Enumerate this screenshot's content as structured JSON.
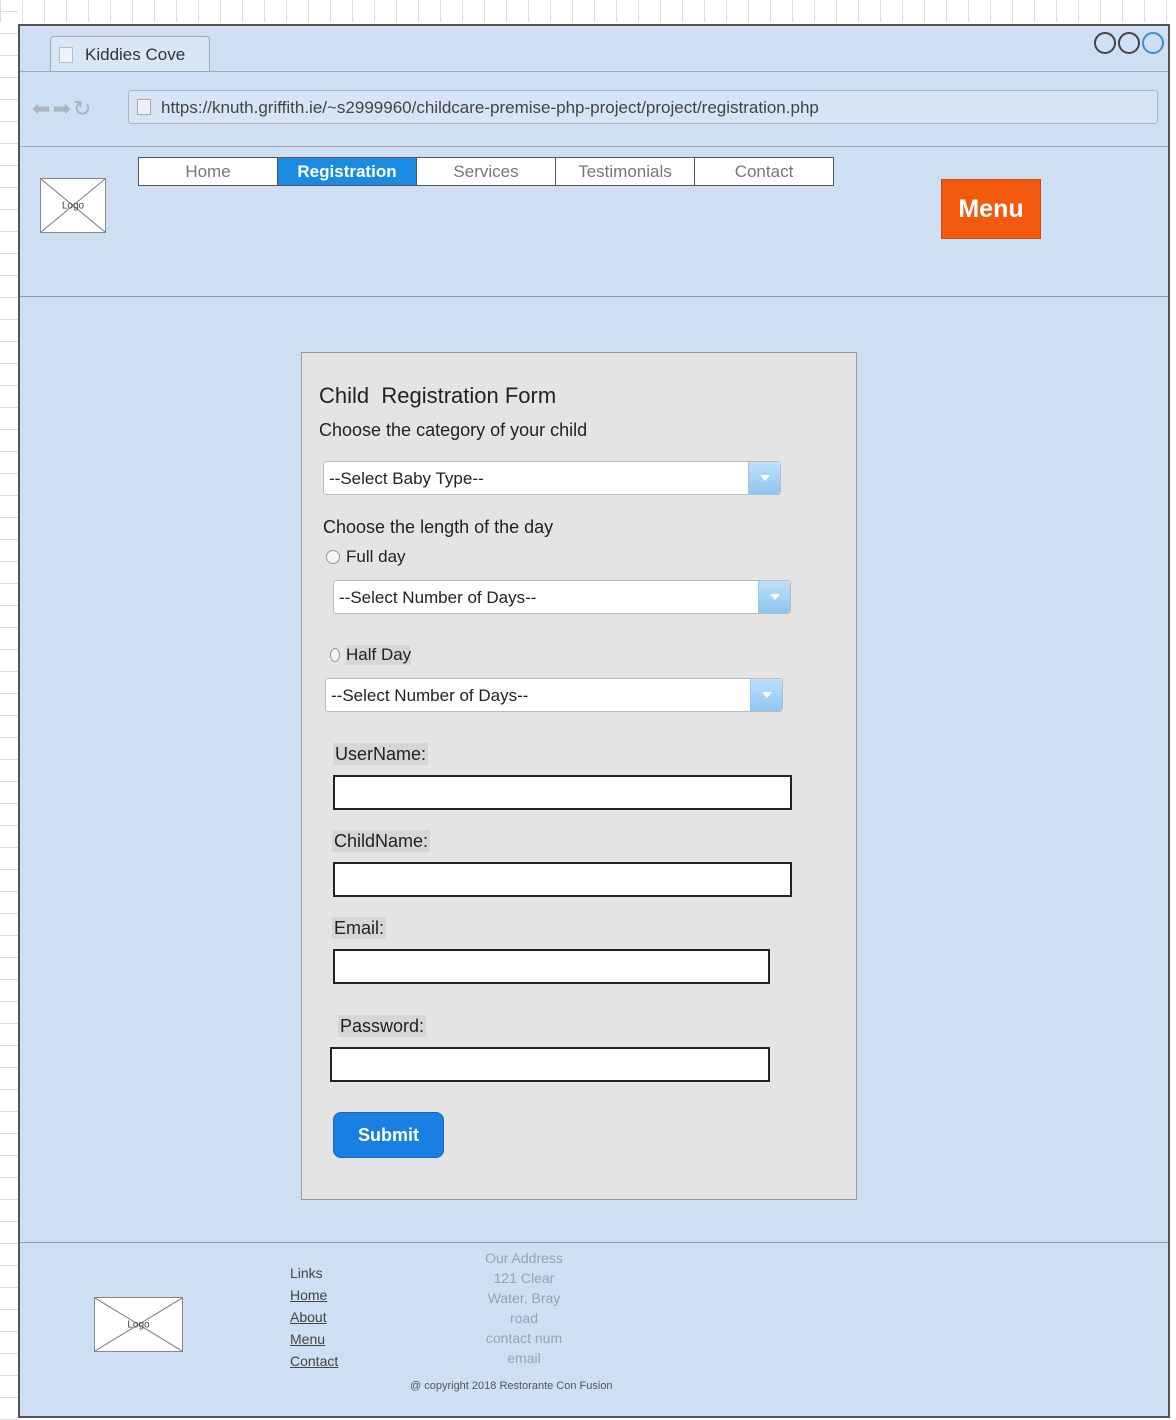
{
  "browser": {
    "tab_title": "Kiddies Cove",
    "url": "https://knuth.griffith.ie/~s2999960/childcare-premise-php-project/project/registration.php"
  },
  "header": {
    "logo_label": "Logo",
    "nav": [
      {
        "label": "Home"
      },
      {
        "label": "Registration"
      },
      {
        "label": "Services"
      },
      {
        "label": "Testimonials"
      },
      {
        "label": "Contact"
      }
    ],
    "active_nav": "Registration",
    "menu_label": "Menu"
  },
  "form": {
    "title": "Child  Registration Form",
    "category_prompt": "Choose the category of your child",
    "baby_type_select": "--Select Baby Type--",
    "day_length_prompt": "Choose the length of the day",
    "full_day_label": "Full day",
    "full_day_select": "--Select Number of Days--",
    "half_day_label": "Half Day",
    "half_day_select": "--Select Number of Days--",
    "username_label": "UserName:",
    "childname_label": "ChildName:",
    "email_label": "Email:",
    "password_label": "Password:",
    "submit_label": "Submit"
  },
  "footer": {
    "logo_label": "Logo",
    "links_heading": "Links",
    "links": [
      "Home",
      "About",
      "Menu",
      "Contact"
    ],
    "address": [
      "Our Address",
      "121 Clear",
      "Water, Bray",
      "road",
      "contact num",
      "email"
    ],
    "copyright": "@ copyright 2018 Restorante Con Fusion"
  },
  "colors": {
    "page_bg": "#cfdff3",
    "nav_active": "#1a8be0",
    "menu_button": "#f25a0f",
    "submit_button": "#1a7fe2"
  }
}
